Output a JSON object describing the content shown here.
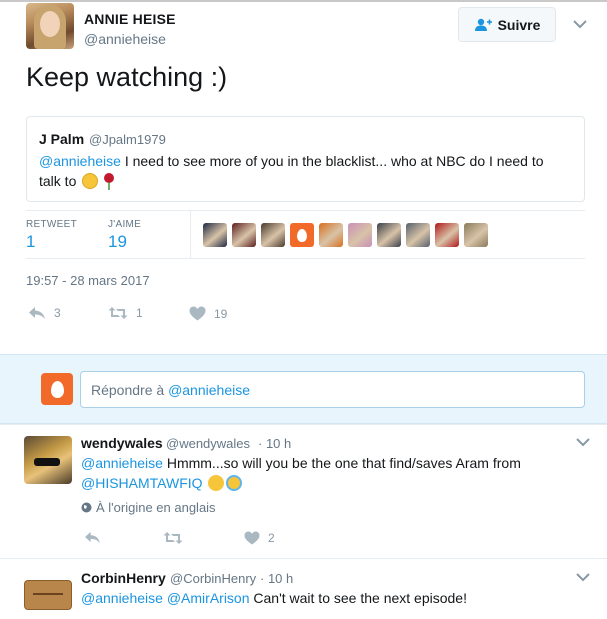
{
  "author": {
    "name": "ANNIE HEISE",
    "handle": "@annieheise"
  },
  "follow_button": {
    "label": "Suivre"
  },
  "tweet": {
    "text": "Keep watching :)",
    "timestamp": "19:57 - 28 mars 2017"
  },
  "quote": {
    "name": "J Palm",
    "handle": "@Jpalm1979",
    "mention": "@annieheise",
    "text_line": " I need to see more of you in the blacklist... who at NBC do I need to talk to "
  },
  "stats": {
    "retweet_label": "RETWEET",
    "retweet_count": "1",
    "like_label": "J'AIME",
    "like_count": "19",
    "liker_colors": [
      "#1f2a44",
      "#5a1f1f",
      "#4a3a2e",
      "#f26a2a",
      "#d8701f",
      "#c98fb7",
      "#3a3f4a",
      "#55606b",
      "#b01818",
      "#8a7a5a"
    ]
  },
  "actions": {
    "reply_count": "3",
    "retweet_count": "1",
    "like_count": "19"
  },
  "reply_box": {
    "placeholder_prefix": "Répondre à ",
    "placeholder_mention": "@annieheise"
  },
  "replies": [
    {
      "name": "wendywales",
      "handle": "@wendywales",
      "time": "· 10 h",
      "mention1": "@annieheise",
      "text1": " Hmmm...so will you be the one that find/saves Aram from",
      "mention2": "@HISHAMTAWFIQ",
      "origin": "À l'origine en anglais",
      "like_count": "2"
    },
    {
      "name": "CorbinHenry",
      "handle": "@CorbinHenry",
      "time": "· 10 h",
      "mention1": "@annieheise",
      "mention2": "@AmirArison",
      "text": " Can't wait to see the next episode!"
    }
  ],
  "colors": {
    "link": "#1b95e0",
    "muted": "#657786",
    "egg": "#f26a2a"
  }
}
